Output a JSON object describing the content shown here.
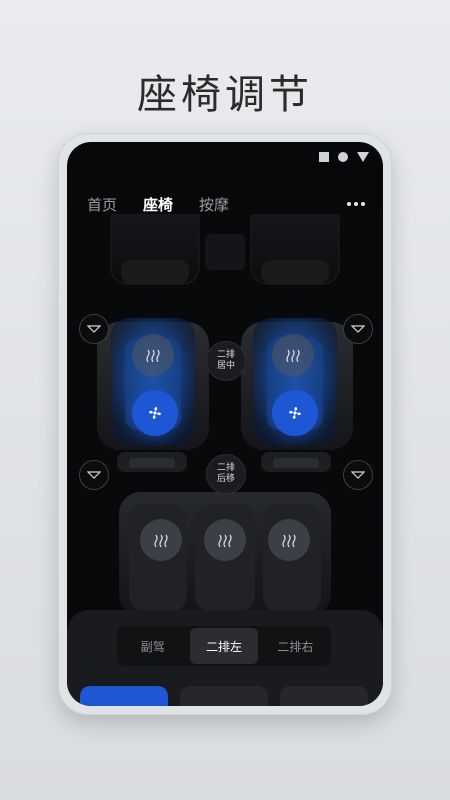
{
  "headline": "座椅调节",
  "status_icons": [
    "square-icon",
    "circle-icon",
    "triangle-icon"
  ],
  "tabs": [
    {
      "label": "首页",
      "active": false
    },
    {
      "label": "座椅",
      "active": true
    },
    {
      "label": "按摩",
      "active": false
    }
  ],
  "seat_controls": {
    "middle_center_line1": "二排",
    "middle_center_line2": "居中",
    "middle_back_line1": "二排",
    "middle_back_line2": "后移"
  },
  "segment": {
    "items": [
      {
        "label": "副驾",
        "active": false
      },
      {
        "label": "二排左",
        "active": true
      },
      {
        "label": "二排右",
        "active": false
      }
    ]
  },
  "colors": {
    "accent": "#1e57d6",
    "seat_highlight": "#1f5fc4",
    "background": "#070809"
  }
}
